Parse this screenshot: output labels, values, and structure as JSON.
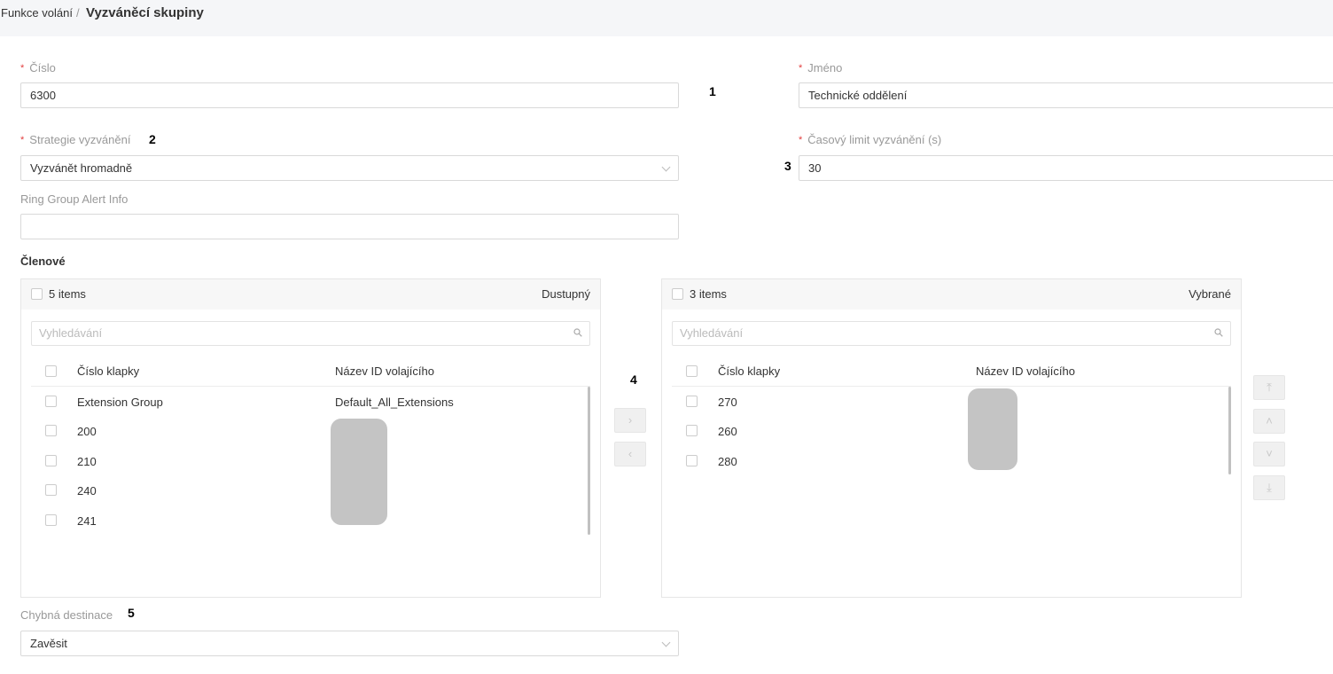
{
  "breadcrumb": {
    "parent": "Funkce volání",
    "separator": "/",
    "current": "Vyzváněcí skupiny"
  },
  "form": {
    "number": {
      "label": "Číslo",
      "value": "6300"
    },
    "name": {
      "label": "Jméno",
      "value": "Technické oddělení"
    },
    "strategy": {
      "label": "Strategie vyzvánění",
      "value": "Vyzvánět hromadně"
    },
    "timeout": {
      "label": "Časový limit vyzvánění (s)",
      "value": "30"
    },
    "alert_info": {
      "label": "Ring Group Alert Info",
      "value": ""
    },
    "members_title": "Členové",
    "fail_dest": {
      "label": "Chybná destinace",
      "value": "Zavěsit"
    }
  },
  "markers": [
    "1",
    "2",
    "3",
    "4",
    "5"
  ],
  "available": {
    "count_label": "5 items",
    "type_label": "Dustupný",
    "search_placeholder": "Vyhledávání",
    "col_ext": "Číslo klapky",
    "col_caller": "Název ID volajícího",
    "rows": [
      {
        "ext": "Extension Group",
        "caller": "Default_All_Extensions"
      },
      {
        "ext": "200",
        "caller": ""
      },
      {
        "ext": "210",
        "caller": ""
      },
      {
        "ext": "240",
        "caller": ""
      },
      {
        "ext": "241",
        "caller": ""
      }
    ]
  },
  "selected": {
    "count_label": "3 items",
    "type_label": "Vybrané",
    "search_placeholder": "Vyhledávání",
    "col_ext": "Číslo klapky",
    "col_caller": "Název ID volajícího",
    "rows": [
      {
        "ext": "270",
        "caller": ""
      },
      {
        "ext": "260",
        "caller": ""
      },
      {
        "ext": "280",
        "caller": ""
      }
    ]
  },
  "transfer": {
    "move_right": "›",
    "move_left": "‹"
  },
  "order_buttons": {
    "top": "⤒",
    "up": "˄",
    "down": "˅",
    "bottom": "⤓"
  },
  "icons": {
    "search": "search-icon",
    "dropdown": "chevron-down-icon"
  }
}
